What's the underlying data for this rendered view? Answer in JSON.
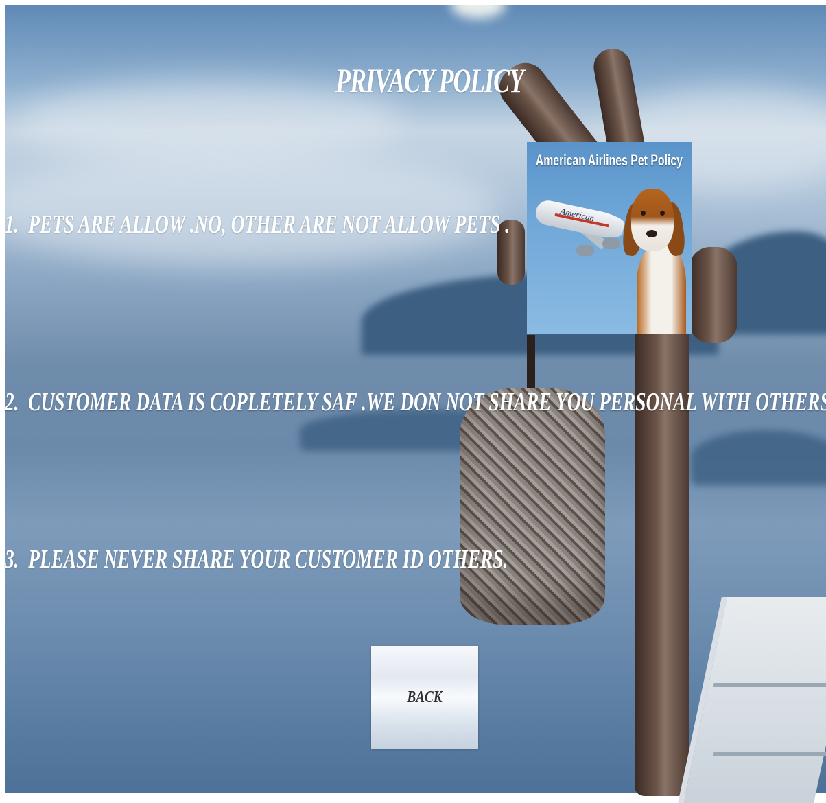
{
  "page": {
    "title": "PRIVACY POLICY"
  },
  "policies": [
    {
      "number": "1.",
      "text": "PETS ARE ALLOW .NO, OTHER ARE NOT ALLOW PETS ."
    },
    {
      "number": "2.",
      "text": "CUSTOMER DATA IS COPLETELY SAF .WE DON NOT SHARE YOU PERSONAL WITH OTHERS ."
    },
    {
      "number": "3.",
      "text": "PLEASE NEVER SHARE YOUR CUSTOMER ID OTHERS."
    }
  ],
  "pet_card": {
    "title": "American Airlines Pet Policy",
    "plane_text": "American"
  },
  "back_button": {
    "label": "BACK"
  },
  "colors": {
    "text": "#ffffff",
    "button_text": "#2e2e2e"
  }
}
